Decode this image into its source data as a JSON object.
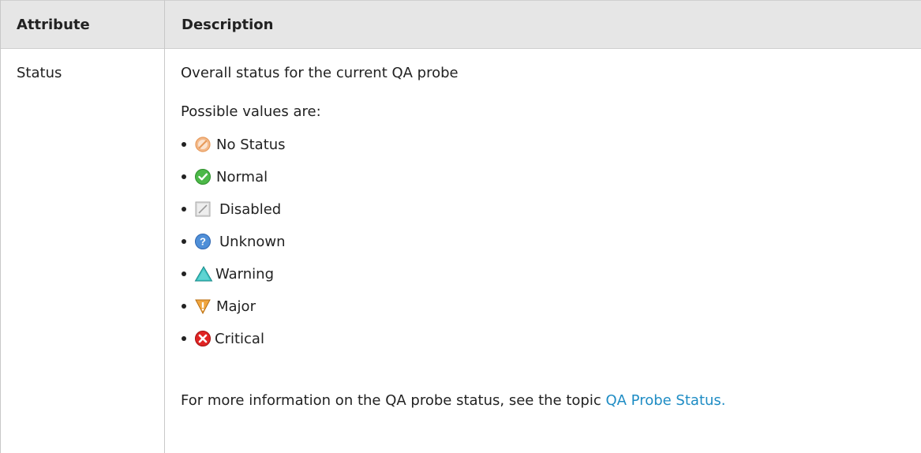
{
  "table": {
    "headers": {
      "attribute": "Attribute",
      "description": "Description"
    },
    "row": {
      "attribute": "Status",
      "intro": "Overall status for the current QA probe",
      "values_label": "Possible values are:",
      "values": [
        {
          "label": "No Status",
          "icon": "no-status-icon"
        },
        {
          "label": "Normal",
          "icon": "normal-icon"
        },
        {
          "label": "Disabled",
          "icon": "disabled-icon"
        },
        {
          "label": "Unknown",
          "icon": "unknown-icon"
        },
        {
          "label": "Warning",
          "icon": "warning-icon"
        },
        {
          "label": "Major",
          "icon": "major-icon"
        },
        {
          "label": "Critical",
          "icon": "critical-icon"
        }
      ],
      "footer_text": "For more information on the QA probe status, see the topic ",
      "footer_link": "QA Probe Status."
    }
  },
  "colors": {
    "header_bg": "#e6e6e6",
    "link": "#1e8cc4"
  }
}
